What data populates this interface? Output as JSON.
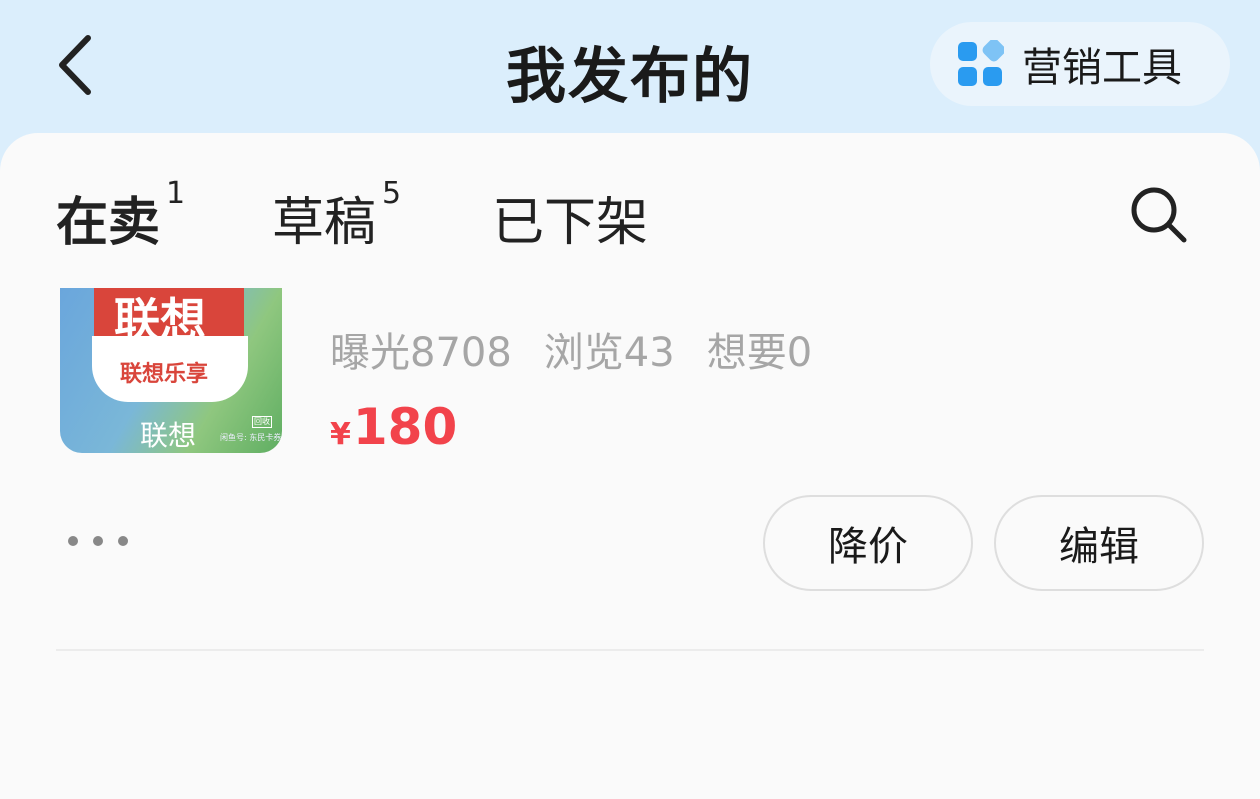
{
  "header": {
    "title": "我发布的",
    "marketing_label": "营销工具"
  },
  "tabs": [
    {
      "label": "在卖",
      "count": "1"
    },
    {
      "label": "草稿",
      "count": "5"
    },
    {
      "label": "已下架",
      "count": ""
    }
  ],
  "listing": {
    "thumbnail": {
      "brand_text": "联想",
      "card_text": "联想乐享",
      "bottom_text": "联想",
      "badge_text": "回收",
      "fine_print": "闲鱼号: 东民卡券"
    },
    "stats": {
      "exposure": "曝光8708",
      "views": "浏览43",
      "wants": "想要0"
    },
    "price": {
      "currency": "¥",
      "amount": "180"
    },
    "actions": {
      "reduce_price": "降价",
      "edit": "编辑"
    }
  },
  "colors": {
    "header_bg": "#dbeefc",
    "price": "#f2434b",
    "tab_highlight": "#ffe03c",
    "icon_blue": "#2a9bf0"
  },
  "icons": {
    "back": "back-icon",
    "marketing": "grid-icon",
    "search": "search-icon",
    "more": "more-icon"
  }
}
